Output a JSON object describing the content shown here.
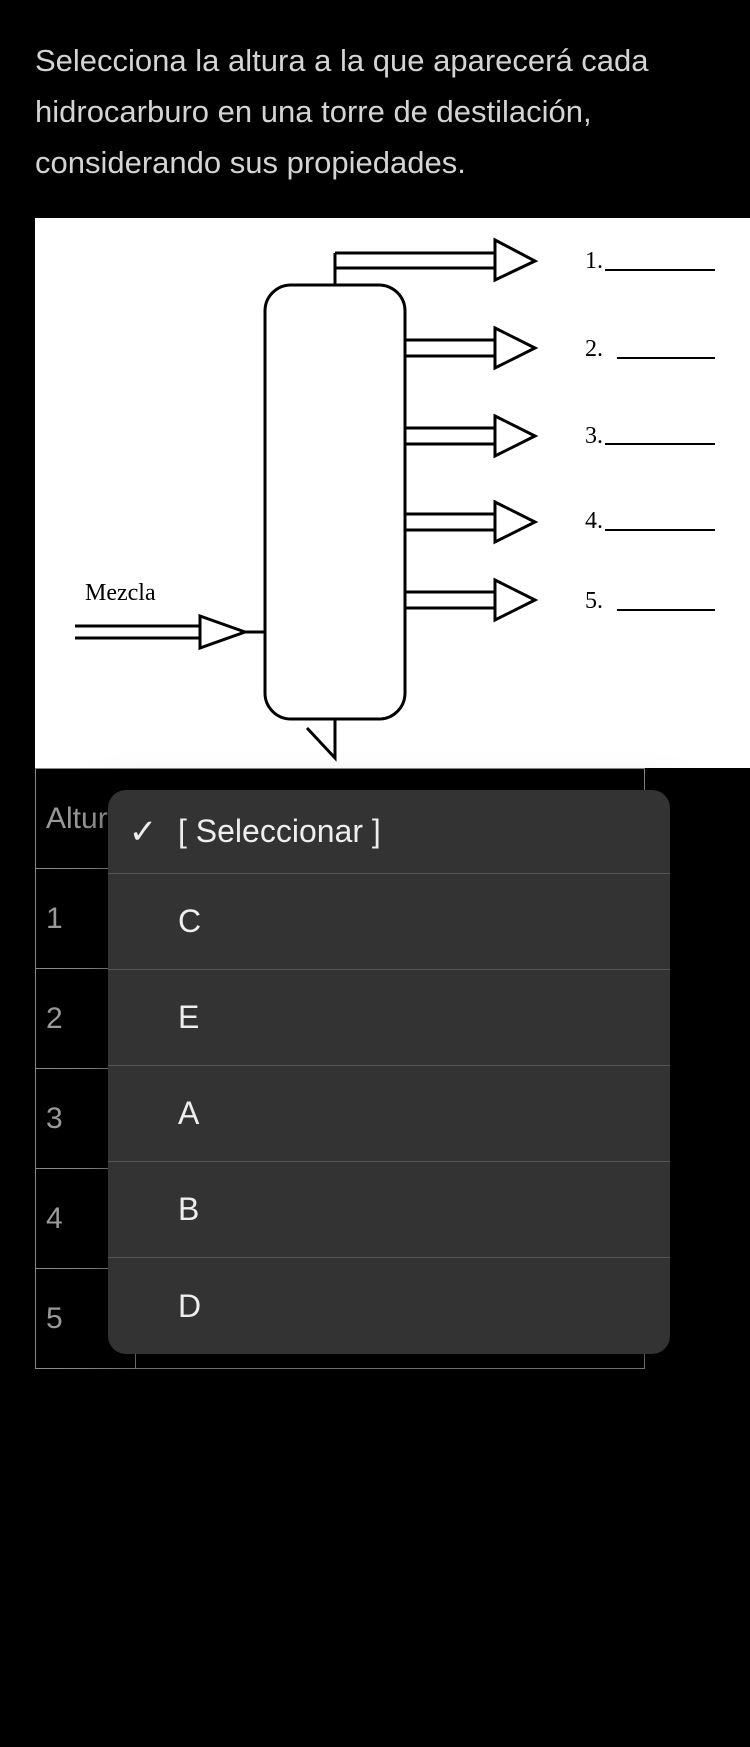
{
  "instruction": "Selecciona la altura a la que aparecerá cada hidrocarburo en una torre de destilación, considerando sus propiedades.",
  "diagram": {
    "inlet_label": "Mezcla",
    "outlets": [
      "1.",
      "2.",
      "3.",
      "4.",
      "5."
    ]
  },
  "table": {
    "header": "Altur",
    "rows": [
      "1",
      "2",
      "3",
      "4",
      "5"
    ]
  },
  "select": {
    "placeholder": "[ Seleccionar ]"
  },
  "dropdown": {
    "selected_label": "[ Seleccionar ]",
    "check": "✓",
    "options": [
      "C",
      "E",
      "A",
      "B",
      "D"
    ]
  }
}
